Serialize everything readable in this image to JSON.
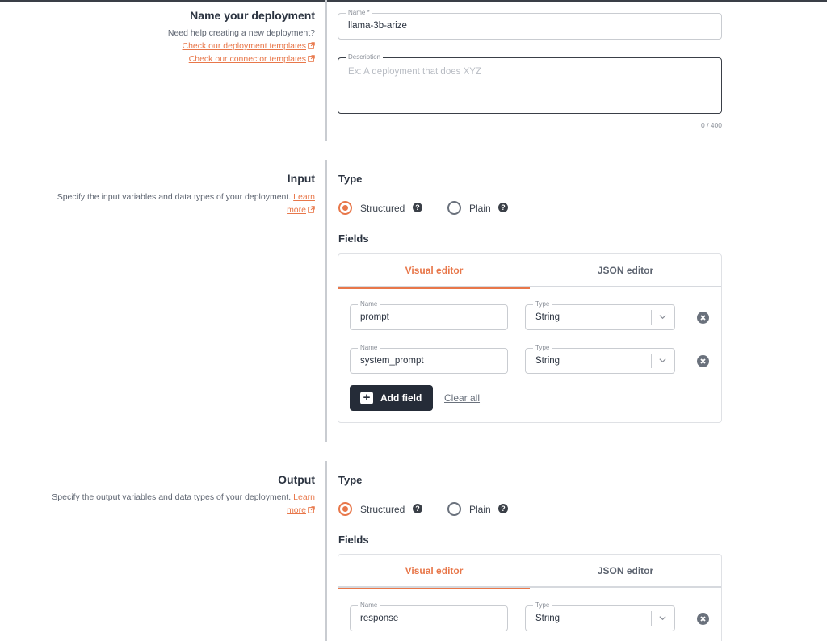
{
  "deployment": {
    "title": "Name your deployment",
    "help_text": "Need help creating a new deployment?",
    "templates_link": "Check our deployment templates",
    "connector_link": "Check our connector templates",
    "name_label": "Name *",
    "name_value": "llama-3b-arize",
    "description_label": "Description",
    "description_placeholder": "Ex: A deployment that does XYZ",
    "description_counter": "0 / 400"
  },
  "input": {
    "title": "Input",
    "description": "Specify the input variables and data types of your deployment.",
    "learn_more_1": "Learn",
    "learn_more_2": "more",
    "type_heading": "Type",
    "structured_label": "Structured",
    "plain_label": "Plain",
    "fields_heading": "Fields",
    "tab_visual": "Visual editor",
    "tab_json": "JSON editor",
    "fields": [
      {
        "name_label": "Name",
        "name": "prompt",
        "type_label": "Type",
        "type": "String"
      },
      {
        "name_label": "Name",
        "name": "system_prompt",
        "type_label": "Type",
        "type": "String"
      }
    ],
    "add_field": "Add field",
    "clear_all": "Clear all"
  },
  "output": {
    "title": "Output",
    "description": "Specify the output variables and data types of your deployment.",
    "learn_more_1": "Learn",
    "learn_more_2": "more",
    "type_heading": "Type",
    "structured_label": "Structured",
    "plain_label": "Plain",
    "fields_heading": "Fields",
    "tab_visual": "Visual editor",
    "tab_json": "JSON editor",
    "fields": [
      {
        "name_label": "Name",
        "name": "response",
        "type_label": "Type",
        "type": "String"
      }
    ]
  },
  "colors": {
    "accent": "#e8774a",
    "dark_button": "#252c38",
    "border": "#c9ccd1"
  },
  "icons": [
    "external-link-icon",
    "help-icon",
    "chevron-down-icon",
    "remove-icon",
    "plus-icon"
  ]
}
